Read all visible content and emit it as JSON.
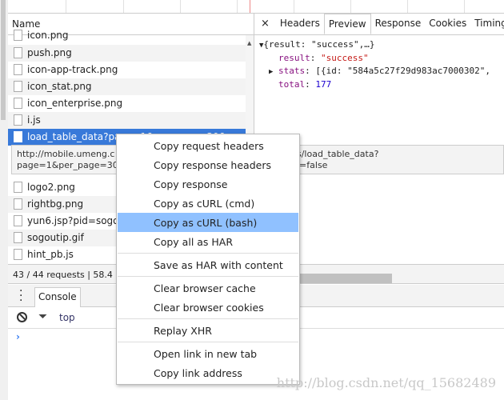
{
  "network": {
    "name_header": "Name",
    "rows": [
      "icon.png",
      "push.png",
      "icon-app-track.png",
      "icon_stat.png",
      "icon_enterprise.png",
      "i.js",
      "load_table_data?page=1&per_page=30&..."
    ],
    "rows_after": [
      "logo2.png",
      "rightbg.png",
      "yun6.jsp?pid=sogou-...",
      "sogoutip.gif",
      "hint_pb.js"
    ],
    "tooltip": {
      "line1": "http://mobile.umeng.c",
      "line2": "page=1&per_page=30&",
      "line1_right": "s/load_table_data?",
      "line2_right": "l=false"
    },
    "status": "43 / 44 requests | 58.4 KB"
  },
  "detail": {
    "close": "×",
    "tabs": [
      "Headers",
      "Preview",
      "Response",
      "Cookies",
      "Timing"
    ],
    "active_tab": "Preview",
    "preview": {
      "summary": "{result: \"success\",…}",
      "result_key": "result",
      "result_val": "\"success\"",
      "stats_key": "stats",
      "stats_val": "[{id: \"584a5c27f29d983ac7000302\",",
      "total_key": "total",
      "total_val": "177"
    }
  },
  "console": {
    "tab": "Console",
    "context": "top",
    "prompt": "›"
  },
  "menu": {
    "items": [
      "Copy request headers",
      "Copy response headers",
      "Copy response",
      "Copy as cURL (cmd)",
      "Copy as cURL (bash)",
      "Copy all as HAR",
      "Save as HAR with content",
      "Clear browser cache",
      "Clear browser cookies",
      "Replay XHR",
      "Open link in new tab",
      "Copy link address"
    ],
    "highlighted": "Copy as cURL (bash)",
    "highlight_color": "#90c1ff"
  },
  "watermark": "http://blog.csdn.net/qq_15682489"
}
